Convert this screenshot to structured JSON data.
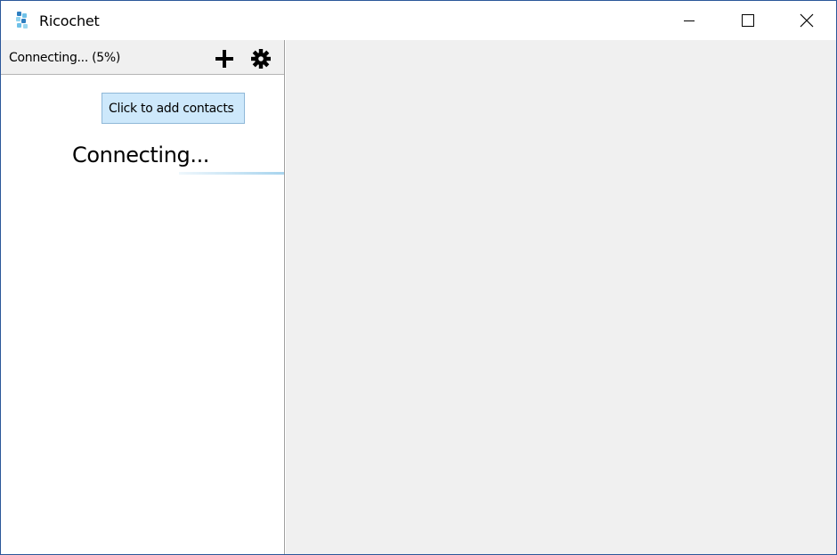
{
  "window": {
    "title": "Ricochet"
  },
  "status_bar": {
    "status_text": "Connecting... (5%)",
    "progress_percent": 5
  },
  "toolbar": {
    "add_icon": "plus-icon",
    "settings_icon": "gear-icon"
  },
  "tooltip": {
    "text": "Click to add contacts"
  },
  "contact_list": {
    "connecting_label": "Connecting..."
  },
  "colors": {
    "window_border": "#2b579a",
    "tooltip_bg": "#cde8fb",
    "pane_bg": "#f0f0f0"
  }
}
